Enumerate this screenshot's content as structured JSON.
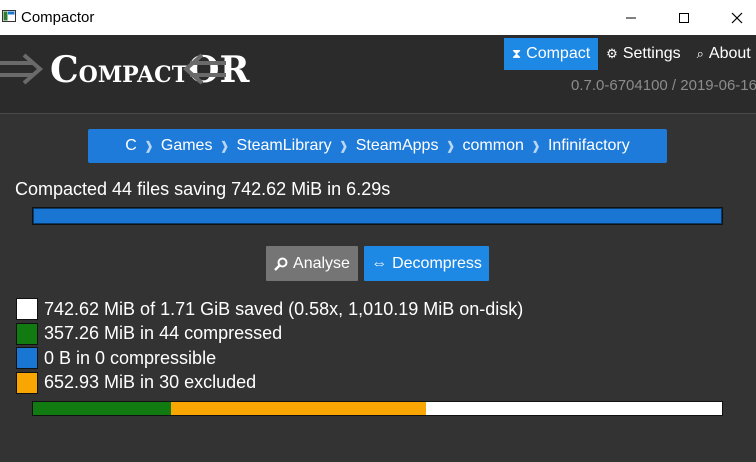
{
  "window": {
    "title": "Compactor"
  },
  "header": {
    "logo": {
      "big_c": "C",
      "small_ompact": "OMPACT",
      "big_o": "O",
      "big_r": "R"
    },
    "nav": [
      {
        "label": "Compact",
        "icon": "hourglass-icon",
        "active": true
      },
      {
        "label": "Settings",
        "icon": "gear-icon",
        "active": false
      },
      {
        "label": "About",
        "icon": "search-icon",
        "active": false
      }
    ],
    "version": "0.7.0-6704100 / 2019-06-16"
  },
  "breadcrumb": [
    "C",
    "Games",
    "SteamLibrary",
    "SteamApps",
    "common",
    "Infinifactory"
  ],
  "status": {
    "text": "Compacted 44 files saving 742.62 MiB in 6.29s",
    "progress": 1.0
  },
  "actions": {
    "analyse_label": "Analyse",
    "decompress_label": "Decompress"
  },
  "legend": [
    {
      "text": "742.62 MiB of 1.71 GiB saved (0.58x, 1,010.19 MiB on-disk)",
      "color": "#ffffff"
    },
    {
      "text": "357.26 MiB in 44 compressed",
      "color": "#117a11"
    },
    {
      "text": "0 B in 0 compressible",
      "color": "#1976d2"
    },
    {
      "text": "652.93 MiB in 30 excluded",
      "color": "#f9a602"
    }
  ],
  "breakdown": [
    {
      "name": "compressed",
      "fraction": 0.2,
      "color": "#117a11"
    },
    {
      "name": "compressible",
      "fraction": 0.0,
      "color": "#1976d2"
    },
    {
      "name": "excluded",
      "fraction": 0.37,
      "color": "#f9a602"
    },
    {
      "name": "saved",
      "fraction": 0.43,
      "color": "#ffffff"
    }
  ]
}
